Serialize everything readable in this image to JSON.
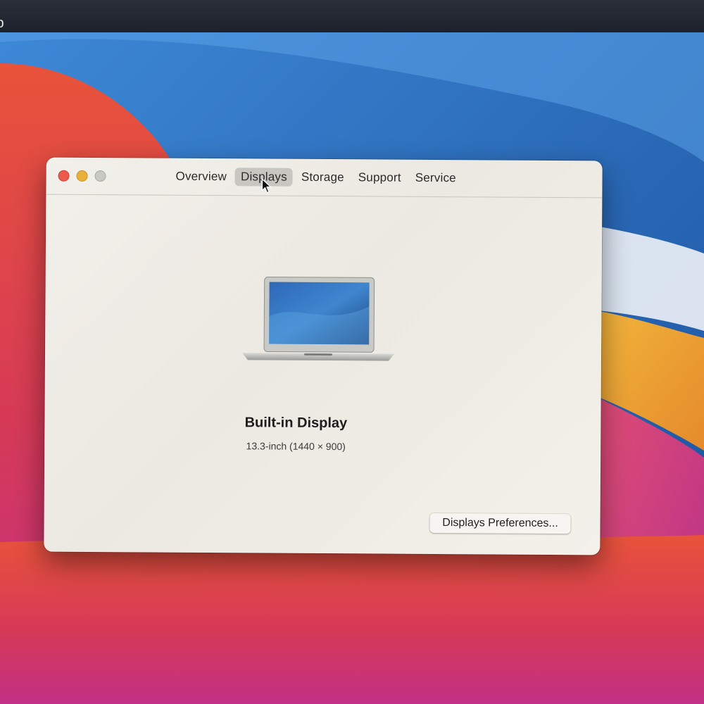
{
  "menubar": {
    "partial_menu_label": "lp"
  },
  "window": {
    "tabs": [
      {
        "label": "Overview"
      },
      {
        "label": "Displays"
      },
      {
        "label": "Storage"
      },
      {
        "label": "Support"
      },
      {
        "label": "Service"
      }
    ],
    "selected_tab": "Displays"
  },
  "display": {
    "name": "Built-in Display",
    "spec": "13.3-inch (1440 × 900)"
  },
  "buttons": {
    "preferences_label": "Displays Preferences..."
  },
  "icons": {
    "close": "close-icon",
    "minimize": "minimize-icon",
    "zoom": "zoom-icon",
    "laptop": "laptop-icon",
    "cursor": "pointer-cursor-icon"
  },
  "colors": {
    "close": "#ec5a4e",
    "minimize": "#e8b23a",
    "zoom": "#c9c9c3",
    "selected_tab": "#c8c6c1",
    "window_bg": "#f1f0ea",
    "menubar_bg": "#1c212b"
  }
}
